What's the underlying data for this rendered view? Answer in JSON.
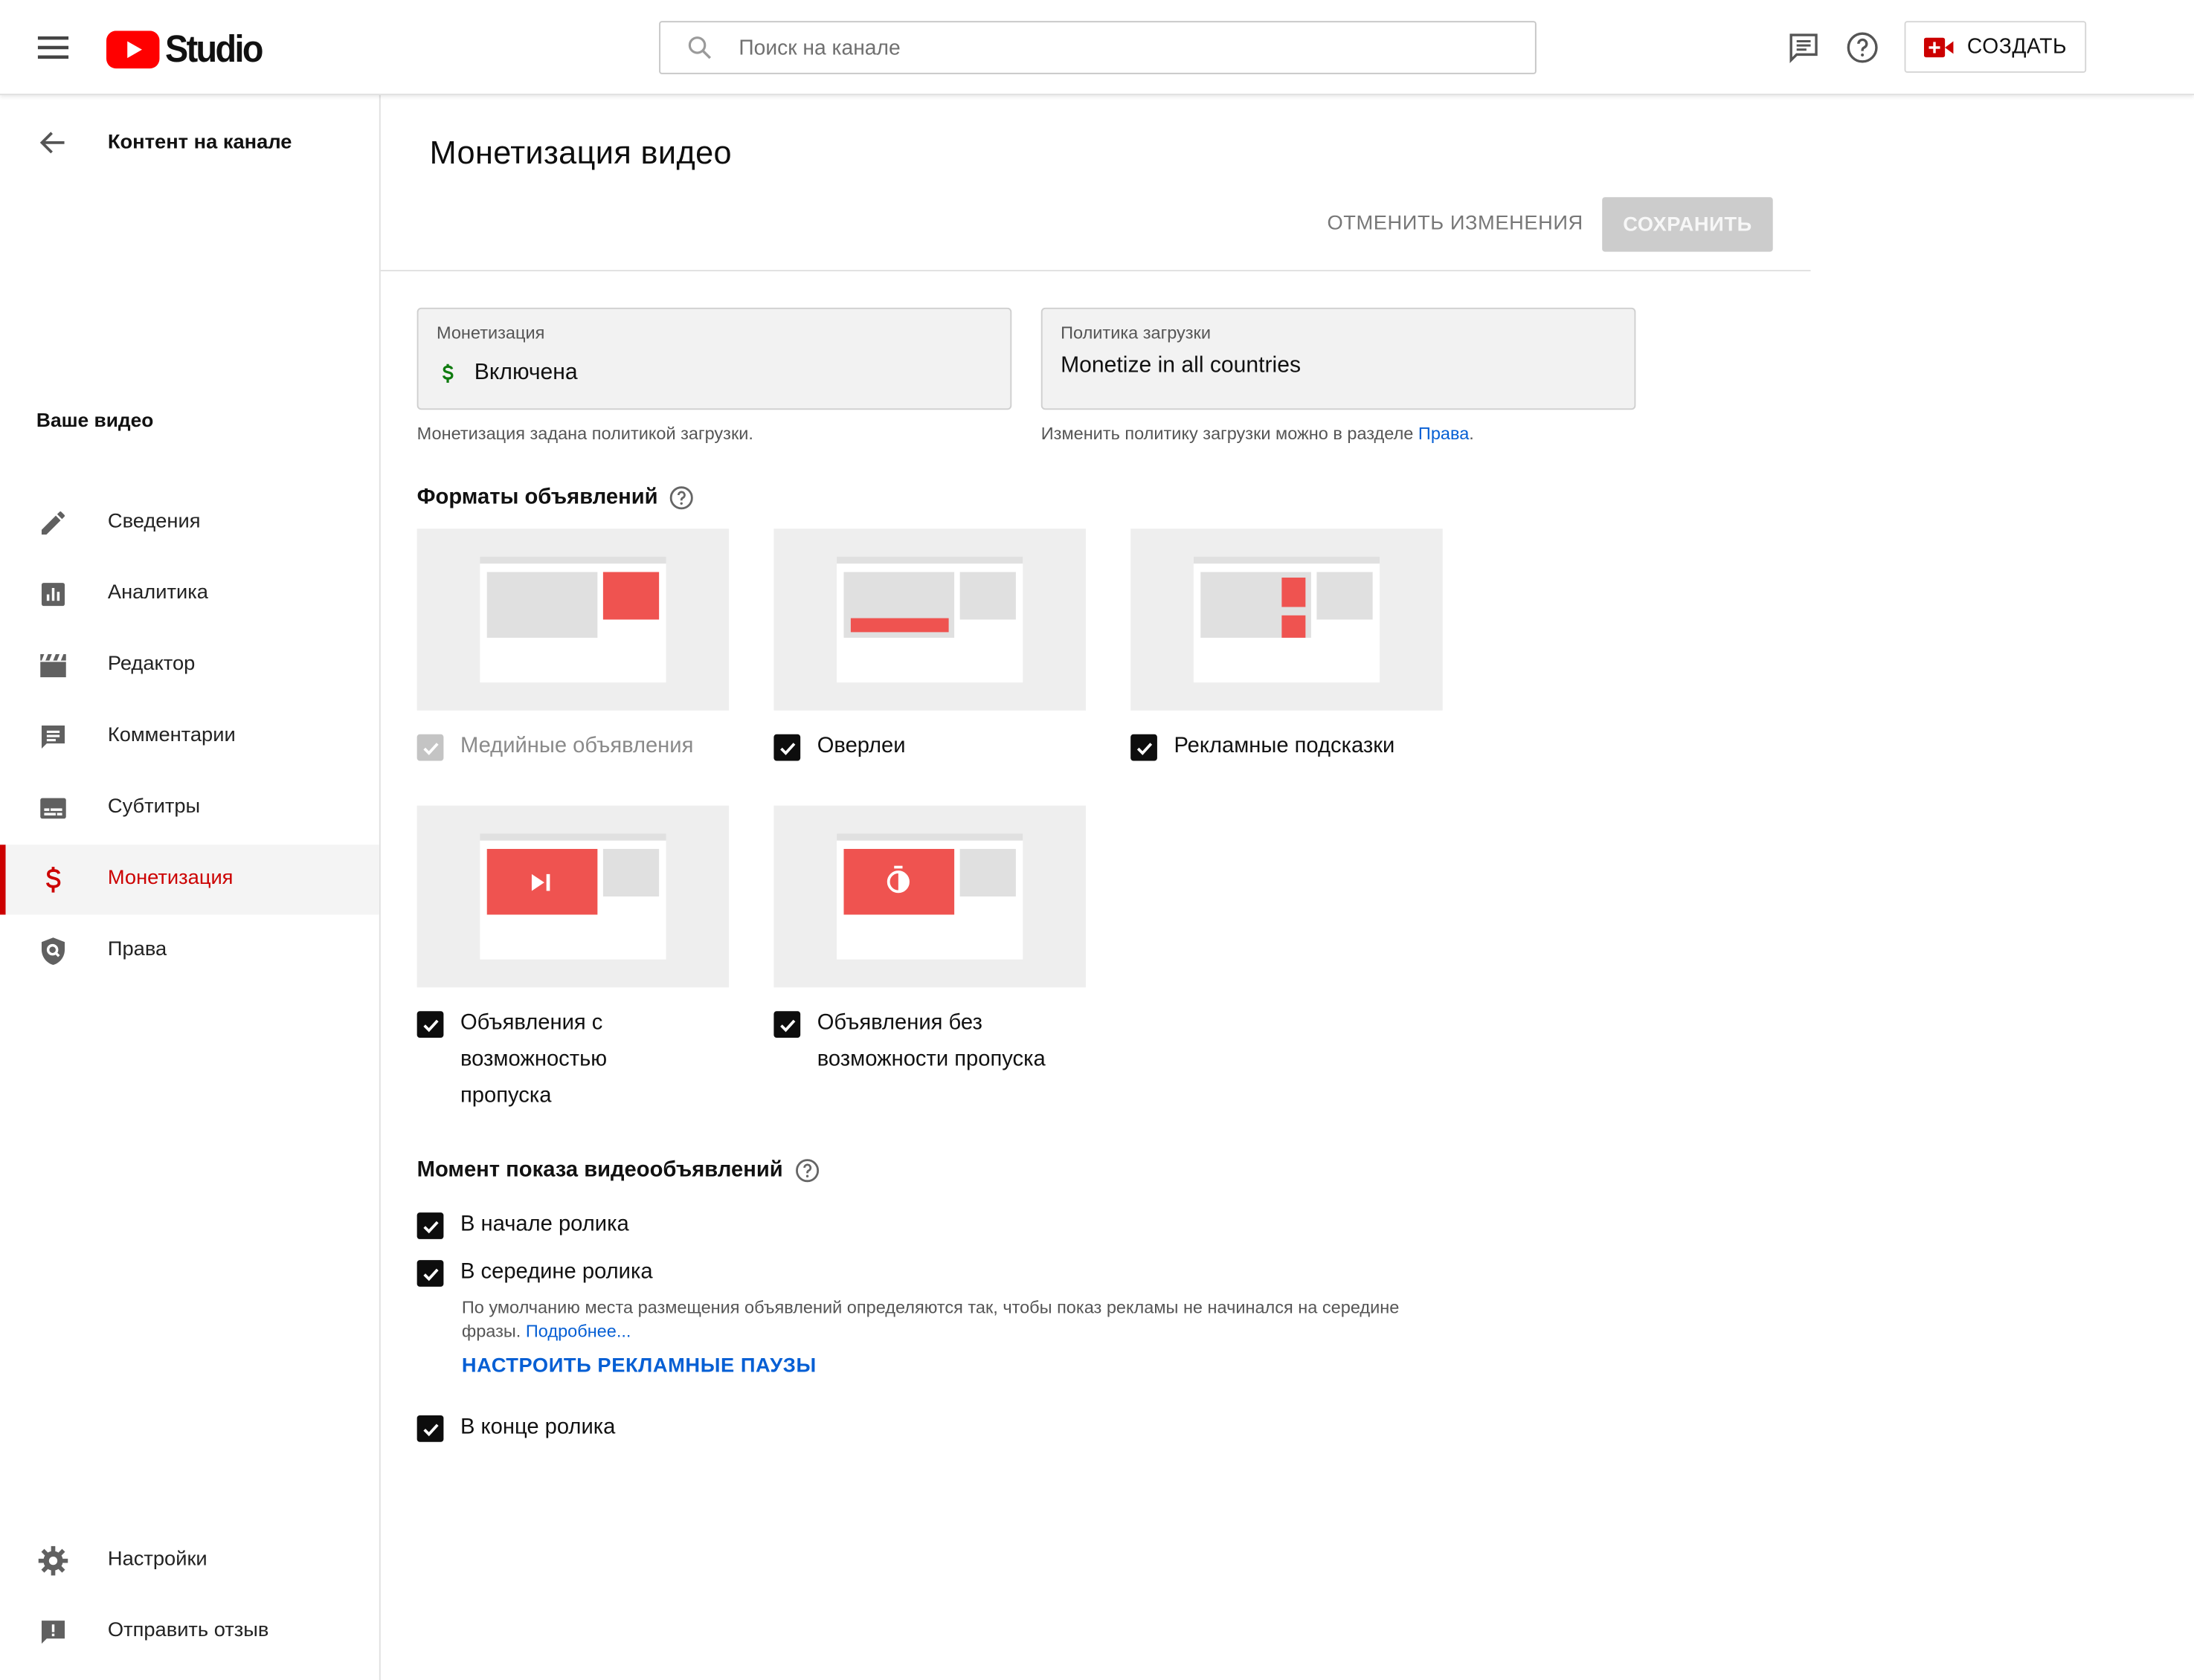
{
  "topbar": {
    "logo_text": "Studio",
    "search_placeholder": "Поиск на канале",
    "create_label": "СОЗДАТЬ"
  },
  "sidebar": {
    "back_label": "Контент на канале",
    "section_title": "Ваше видео",
    "items": [
      {
        "label": "Сведения",
        "icon": "pencil-icon"
      },
      {
        "label": "Аналитика",
        "icon": "analytics-icon"
      },
      {
        "label": "Редактор",
        "icon": "clapperboard-icon"
      },
      {
        "label": "Комментарии",
        "icon": "comment-icon"
      },
      {
        "label": "Субтитры",
        "icon": "subtitles-icon"
      },
      {
        "label": "Монетизация",
        "icon": "dollar-icon",
        "active": true
      },
      {
        "label": "Права",
        "icon": "shield-icon"
      }
    ],
    "bottom_items": [
      {
        "label": "Настройки",
        "icon": "gear-icon"
      },
      {
        "label": "Отправить отзыв",
        "icon": "feedback-icon"
      }
    ]
  },
  "main": {
    "title": "Монетизация видео",
    "cancel_label": "ОТМЕНИТЬ ИЗМЕНЕНИЯ",
    "save_label": "СОХРАНИТЬ",
    "monetization": {
      "label": "Монетизация",
      "value": "Включена",
      "hint": "Монетизация задана политикой загрузки."
    },
    "upload_policy": {
      "label": "Политика загрузки",
      "value": "Monetize in all countries",
      "hint": "Изменить политику загрузки можно в разделе ",
      "hint_link": "Права",
      "hint_end": "."
    },
    "ad_formats": {
      "title": "Форматы объявлений",
      "items": [
        {
          "label": "Медийные объявления",
          "checked": true,
          "disabled": true
        },
        {
          "label": "Оверлеи",
          "checked": true
        },
        {
          "label": "Рекламные подсказки",
          "checked": true
        },
        {
          "label": "Объявления с возможностью пропуска",
          "checked": true
        },
        {
          "label": "Объявления без возможности пропуска",
          "checked": true
        }
      ]
    },
    "ad_timing": {
      "title": "Момент показа видеообъявлений",
      "pre_roll": "В начале ролика",
      "mid_roll": "В середине ролика",
      "mid_roll_desc": "По умолчанию места размещения объявлений определяются так, чтобы показ рекламы не начинался на середине фразы. ",
      "mid_roll_link": "Подробнее...",
      "configure_label": "НАСТРОИТЬ РЕКЛАМНЫЕ ПАУЗЫ",
      "post_roll": "В конце ролика"
    }
  },
  "colors": {
    "accent_red": "#cc0000",
    "link_blue": "#065fd4",
    "ad_red": "#ef5350",
    "dollar_green": "#0f7b0f"
  }
}
